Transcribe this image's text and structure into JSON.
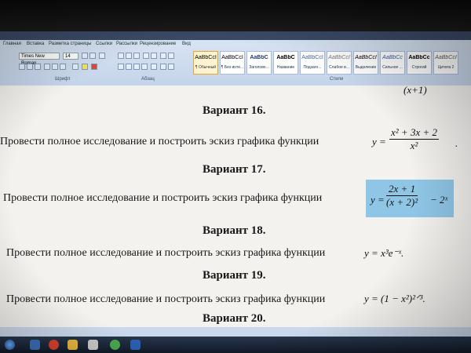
{
  "ribbon": {
    "tabs": [
      "Главная",
      "Вставка",
      "Разметка страницы",
      "Ссылки",
      "Рассылки",
      "Рецензирование",
      "Вид"
    ],
    "font_name": "Times New Roman",
    "font_size": "14",
    "group_font": "Шрифт",
    "group_paragraph": "Абзац",
    "group_styles": "Стили",
    "styles": [
      {
        "sample": "AaBbCcI",
        "name": "¶ Обычный"
      },
      {
        "sample": "AaBbCcI",
        "name": "¶ Без инте..."
      },
      {
        "sample": "AaBbC",
        "name": "Заголово..."
      },
      {
        "sample": "AaBbC",
        "name": "Название"
      },
      {
        "sample": "AaBbCcI",
        "name": "Подзаго..."
      },
      {
        "sample": "AaBbCcI",
        "name": "Слабое в..."
      },
      {
        "sample": "AaBbCcI",
        "name": "Выделение"
      },
      {
        "sample": "AaBbCc",
        "name": "Сильное ..."
      },
      {
        "sample": "AaBbCc",
        "name": "Строгий"
      },
      {
        "sample": "AaBbCcI",
        "name": "Цитата 2"
      }
    ]
  },
  "document": {
    "top_partial": "(x+1)",
    "variants": [
      {
        "heading": "Вариант 16."
      },
      {
        "heading": "Вариант 17."
      },
      {
        "heading": "Вариант 18."
      },
      {
        "heading": "Вариант 19."
      },
      {
        "heading": "Вариант 20."
      }
    ],
    "task_text": "Провести полное исследование и построить эскиз графика функции",
    "f16": {
      "lhs": "y =",
      "num": "x² + 3x + 2",
      "den": "x²",
      "tail": "."
    },
    "f17": {
      "lhs": "y =",
      "num": "2x + 1",
      "den": "(x + 2)²",
      "tail": "− 2ˣ"
    },
    "f18": {
      "text": "y = x³e⁻ˣ."
    },
    "f19": {
      "text": "y = (1 − x²)²ᐟ³."
    }
  },
  "colors": {
    "highlight": "#8fc6e6",
    "ribbon": "#d9e4f3",
    "page": "#f4f2ef"
  }
}
